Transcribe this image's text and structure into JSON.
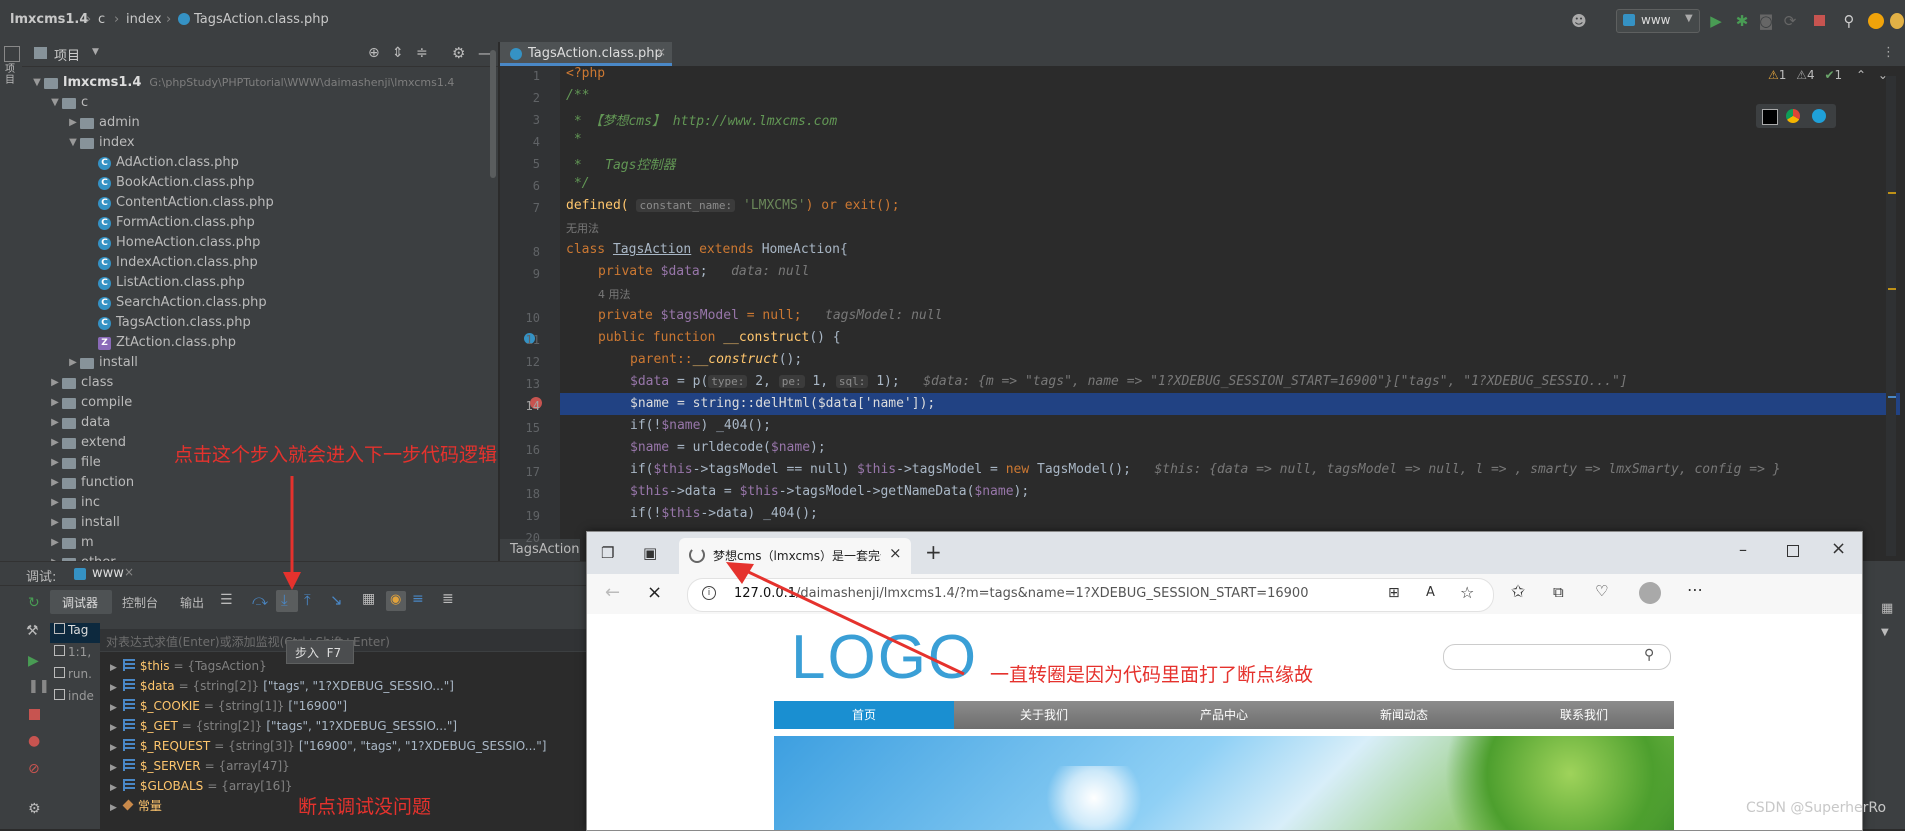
{
  "topbar": {
    "project": "lmxcms1.4",
    "crumb1": "c",
    "crumb2": "index",
    "crumb3": "TagsAction.class.php",
    "run_config": "www"
  },
  "project_panel": {
    "title": "项目",
    "side_label": "项目",
    "root_name": "lmxcms1.4",
    "root_path": "G:\\phpStudy\\PHPTutorial\\WWW\\daimashenji\\lmxcms1.4",
    "tree": [
      {
        "label": "c",
        "depth": 1,
        "kind": "folder",
        "open": true
      },
      {
        "label": "admin",
        "depth": 2,
        "kind": "folder",
        "open": false
      },
      {
        "label": "index",
        "depth": 2,
        "kind": "folder",
        "open": true
      },
      {
        "label": "AdAction.class.php",
        "depth": 3,
        "kind": "php"
      },
      {
        "label": "BookAction.class.php",
        "depth": 3,
        "kind": "php"
      },
      {
        "label": "ContentAction.class.php",
        "depth": 3,
        "kind": "php"
      },
      {
        "label": "FormAction.class.php",
        "depth": 3,
        "kind": "php"
      },
      {
        "label": "HomeAction.class.php",
        "depth": 3,
        "kind": "php"
      },
      {
        "label": "IndexAction.class.php",
        "depth": 3,
        "kind": "php"
      },
      {
        "label": "ListAction.class.php",
        "depth": 3,
        "kind": "php"
      },
      {
        "label": "SearchAction.class.php",
        "depth": 3,
        "kind": "php"
      },
      {
        "label": "TagsAction.class.php",
        "depth": 3,
        "kind": "php"
      },
      {
        "label": "ZtAction.class.php",
        "depth": 3,
        "kind": "php2"
      },
      {
        "label": "install",
        "depth": 2,
        "kind": "folder",
        "open": false
      },
      {
        "label": "class",
        "depth": 1,
        "kind": "folder",
        "open": false
      },
      {
        "label": "compile",
        "depth": 1,
        "kind": "folder",
        "open": false
      },
      {
        "label": "data",
        "depth": 1,
        "kind": "folder",
        "open": false
      },
      {
        "label": "extend",
        "depth": 1,
        "kind": "folder",
        "open": false
      },
      {
        "label": "file",
        "depth": 1,
        "kind": "folder",
        "open": false
      },
      {
        "label": "function",
        "depth": 1,
        "kind": "folder",
        "open": false
      },
      {
        "label": "inc",
        "depth": 1,
        "kind": "folder",
        "open": false
      },
      {
        "label": "install",
        "depth": 1,
        "kind": "folder",
        "open": false
      },
      {
        "label": "m",
        "depth": 1,
        "kind": "folder",
        "open": false
      },
      {
        "label": "other",
        "depth": 1,
        "kind": "folder",
        "open": false
      }
    ]
  },
  "editor": {
    "tab_label": "TagsAction.class.php",
    "inspection": {
      "warn": "1",
      "weak": "4",
      "ok": "1"
    },
    "breadcrumb": "TagsAction",
    "usage_hint_1": "无用法",
    "usage_hint_2": "4 用法",
    "line_numbers": [
      "1",
      "2",
      "3",
      "4",
      "5",
      "6",
      "7",
      "8",
      "9",
      "10",
      "11",
      "12",
      "13",
      "14",
      "15",
      "16",
      "17",
      "18",
      "19",
      "20"
    ],
    "lines": {
      "l1": "<?php",
      "l2": "/**",
      "l3_a": " * ",
      "l3_b": "【梦想cms】 http://www.lmxcms.com",
      "l4": " *",
      "l5_a": " *   ",
      "l5_b": "Tags控制器",
      "l6": " */",
      "l7_a": "defined(",
      "l7_hint": "constant_name:",
      "l7_str": "'LMXCMS'",
      "l7_b": ") or exit();",
      "l8_kw1": "class ",
      "l8_cls": "TagsAction",
      "l8_kw2": " extends ",
      "l8_base": "HomeAction{",
      "l9_kw": "private ",
      "l9_var": "$data",
      "l9_end": ";",
      "l9_hint": "data: null",
      "l10_kw": "private ",
      "l10_var": "$tagsModel",
      "l10_end": " = null;",
      "l10_hint": "tagsModel: null",
      "l11_kw": "public function ",
      "l11_fn": "__construct",
      "l11_end": "() {",
      "l12_a": "parent::",
      "l12_fn": "__construct",
      "l12_b": "();",
      "l13_var": "$data",
      "l13_a": " = p(",
      "l13_h1": "type:",
      "l13_v1": " 2, ",
      "l13_h2": "pe:",
      "l13_v2": " 1, ",
      "l13_h3": "sql:",
      "l13_v3": " 1);",
      "l13_hint": "$data: {m => \"tags\", name => \"1?XDEBUG_SESSION_START=16900\"}[\"tags\", \"1?XDEBUG_SESSIO...\"]",
      "l14": "$name = string::delHtml($data['name']);",
      "l15_a": "if(!",
      "l15_var": "$name",
      "l15_b": ") _404();",
      "l16_var": "$name",
      "l16_a": " = urldecode(",
      "l16_var2": "$name",
      "l16_b": ");",
      "l17_a": "if(",
      "l17_var": "$this",
      "l17_b": "->tagsModel == null) ",
      "l17_var2": "$this",
      "l17_c": "->tagsModel = ",
      "l17_kw": "new ",
      "l17_d": "TagsModel();",
      "l17_hint": "$this: {data => null, tagsModel => null, l => , smarty => lmxSmarty, config => }",
      "l18_var": "$this",
      "l18_a": "->data = ",
      "l18_var2": "$this",
      "l18_b": "->tagsModel->getNameData(",
      "l18_var3": "$name",
      "l18_c": ");",
      "l19_a": "if(!",
      "l19_var": "$this",
      "l19_b": "->data) _404();"
    }
  },
  "debug": {
    "label": "调试:",
    "session": "www",
    "tabs": [
      "调试器",
      "控制台",
      "输出"
    ],
    "eval_placeholder": "对表达式求值(Enter)或添加监视(Ctrl+Shift+Enter)",
    "tooltip": "步入  F7",
    "frames": [
      "Tag",
      "1:1,",
      "run.",
      "inde"
    ],
    "variables": [
      {
        "name": "$this",
        "type": "= {TagsAction}",
        "value": ""
      },
      {
        "name": "$data",
        "type": "= {string[2]}",
        "value": "[\"tags\", \"1?XDEBUG_SESSIO...\"]"
      },
      {
        "name": "$_COOKIE",
        "type": "= {string[1]}",
        "value": "[\"16900\"]"
      },
      {
        "name": "$_GET",
        "type": "= {string[2]}",
        "value": "[\"tags\", \"1?XDEBUG_SESSIO...\"]"
      },
      {
        "name": "$_REQUEST",
        "type": "= {string[3]}",
        "value": "[\"16900\", \"tags\", \"1?XDEBUG_SESSIO...\"]"
      },
      {
        "name": "$_SERVER",
        "type": "= {array[47]}",
        "value": ""
      },
      {
        "name": "$GLOBALS",
        "type": "= {array[16]}",
        "value": ""
      },
      {
        "name": "常量",
        "type": "",
        "value": ""
      }
    ]
  },
  "browser": {
    "tab_title": "梦想cms（lmxcms）是一套完全",
    "url_prefix": "127.0.0.1",
    "url_rest": "/daimashenji/lmxcms1.4/?m=tags&name=1?XDEBUG_SESSION_START=16900",
    "logo": "LOGO",
    "nav": [
      "首页",
      "关于我们",
      "产品中心",
      "新闻动态",
      "联系我们"
    ]
  },
  "annotations": {
    "step_into": "点击这个步入就会进入下一步代码逻辑",
    "spinning": "一直转圈是因为代码里面打了断点缘故",
    "debug_ok": "断点调试没问题"
  },
  "watermark": "CSDN @SuperherRo",
  "colors": {
    "accent": "#214283",
    "annotation": "#e5322d",
    "browser_nav": "#1a8fd1"
  }
}
